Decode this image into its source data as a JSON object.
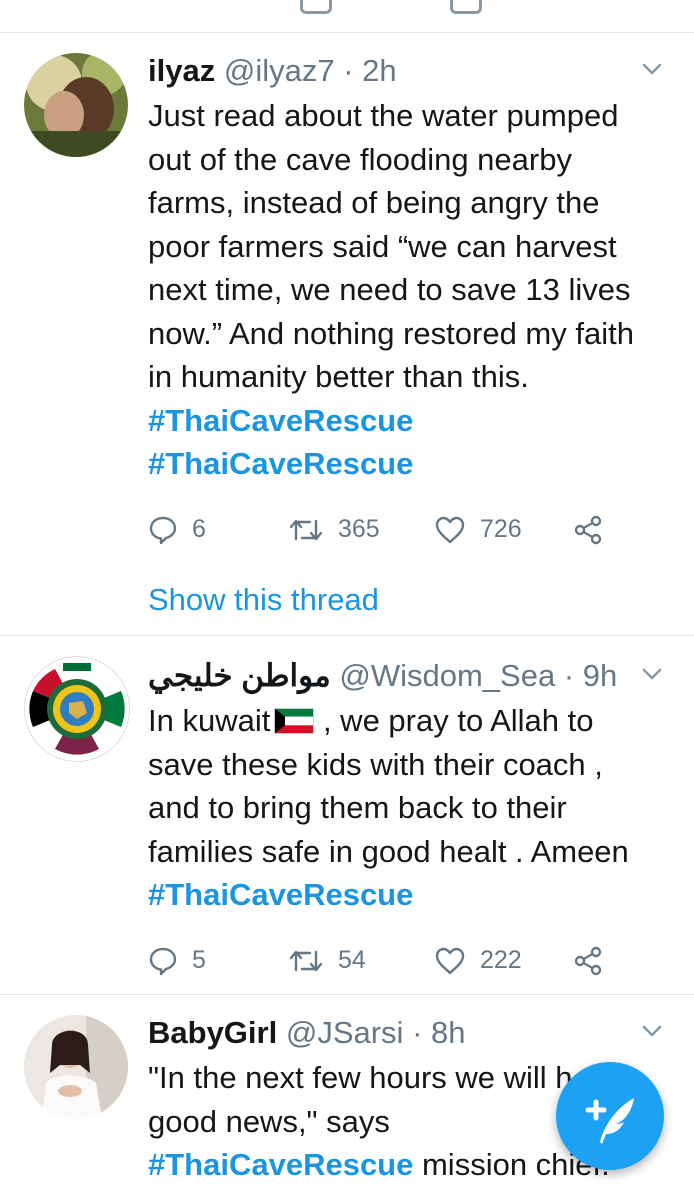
{
  "colors": {
    "accent": "#1da1f2",
    "hashtag": "#1b95e0",
    "muted": "#657786",
    "divider": "#e1e8ed"
  },
  "tweets": [
    {
      "name": "ilyaz",
      "handle": "@ilyaz7",
      "separator": "·",
      "time": "2h",
      "lines": [
        "Just read about the water pumped",
        "out of the cave flooding nearby",
        "farms, instead of being angry the",
        "poor farmers said “we can harvest",
        "next time, we need to save 13 lives",
        "now.” And nothing restored my faith",
        "in humanity better than this."
      ],
      "hashtags": [
        "#ThaiCaveRescue",
        "#ThaiCaveRescue"
      ],
      "replies": "6",
      "retweets": "365",
      "likes": "726",
      "thread_link": "Show this thread"
    },
    {
      "name": "مواطن خليجي",
      "handle": "@Wisdom_Sea",
      "separator": "·",
      "time": "9h",
      "line1_prefix": "In kuwait",
      "flag_icon": "kuwait-flag-icon",
      "line1_suffix": " , we pray to Allah to",
      "lines": [
        "save these kids with their coach ,",
        "and to bring them back to their",
        "families safe in good healt . Ameen"
      ],
      "hashtags": [
        "#ThaiCaveRescue"
      ],
      "replies": "5",
      "retweets": "54",
      "likes": "222"
    },
    {
      "name": "BabyGirl",
      "handle": "@JSarsi",
      "separator": "·",
      "time": "8h",
      "lines": [
        "\"In the next few hours we will h",
        "good news,\" says"
      ],
      "hashtag": "#ThaiCaveRescue",
      "trailing": " mission chief."
    }
  ],
  "fab": {
    "icon": "compose-tweet-icon"
  }
}
